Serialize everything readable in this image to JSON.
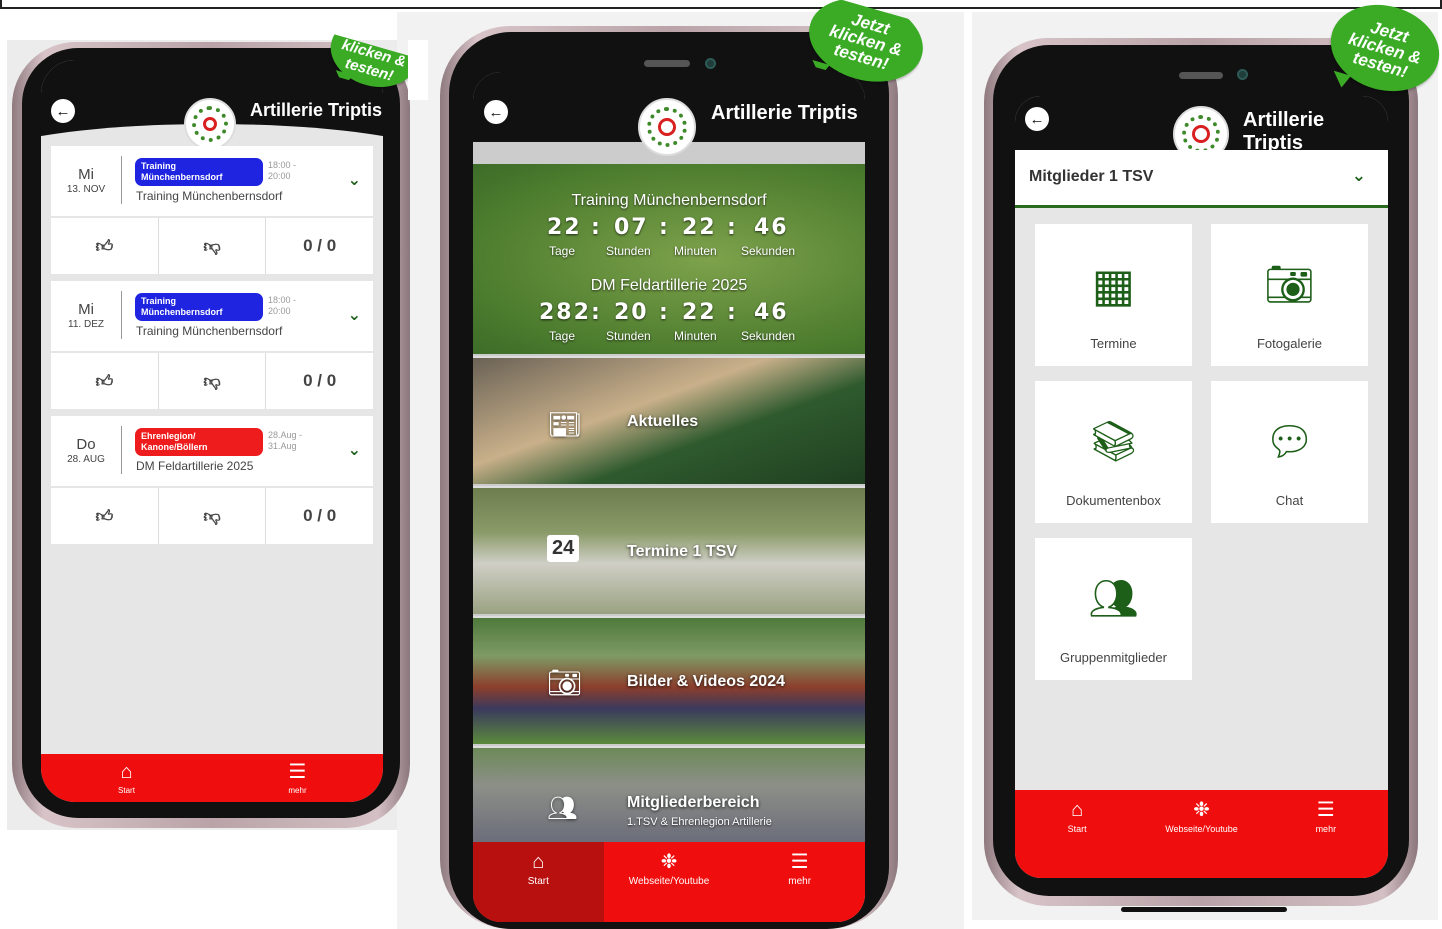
{
  "badge_text": "Jetzt\nklicken &\ntesten!",
  "app_title": "Artillerie Triptis",
  "colors": {
    "brand_green": "#1d5e18",
    "tabbar_red": "#ef0d0d",
    "pill_blue": "#1f24e0",
    "pill_red": "#ee1c1c"
  },
  "phone1": {
    "events": [
      {
        "dow": "Mi",
        "date": "13. NOV",
        "pill": "Training\nMünchenbernsdorf",
        "pill_color": "#1f24e0",
        "time": "18:00 -\n20:00",
        "name": "Training Münchenbernsdorf",
        "count": "0 / 0"
      },
      {
        "dow": "Mi",
        "date": "11. DEZ",
        "pill": "Training\nMünchenbernsdorf",
        "pill_color": "#1f24e0",
        "time": "18:00 -\n20:00",
        "name": "Training Münchenbernsdorf",
        "count": "0 / 0"
      },
      {
        "dow": "Do",
        "date": "28. AUG",
        "pill": "Ehrenlegion/\nKanone/Böllern",
        "pill_color": "#ee1c1c",
        "time": "28.Aug -\n31.Aug",
        "name": "DM Feldartillerie 2025",
        "count": "0 / 0"
      }
    ],
    "tabs": [
      {
        "label": "Start",
        "icon": "home-icon"
      },
      {
        "label": "mehr",
        "icon": "menu-icon"
      }
    ]
  },
  "phone2": {
    "countdowns": [
      {
        "title": "Training Münchenbernsdorf",
        "days": "22",
        "hours": "07",
        "minutes": "22",
        "seconds": "46"
      },
      {
        "title": "DM Feldartillerie 2025",
        "days": "282",
        "hours": "20",
        "minutes": "22",
        "seconds": "46"
      }
    ],
    "units": {
      "days": "Tage",
      "hours": "Stunden",
      "minutes": "Minuten",
      "seconds": "Sekunden"
    },
    "separator": ":",
    "tiles": [
      {
        "label": "Aktuelles",
        "icon": "newspaper-icon",
        "sub": ""
      },
      {
        "label": "Termine 1 TSV",
        "icon": "calendar-icon",
        "sub": "",
        "cal_day": "24"
      },
      {
        "label": "Bilder & Videos 2024",
        "icon": "camera-icon",
        "sub": ""
      },
      {
        "label": "Mitgliederbereich",
        "icon": "group-icon",
        "sub": "1.TSV & Ehrenlegion Artillerie"
      }
    ],
    "tabs": [
      {
        "label": "Start",
        "icon": "home-icon"
      },
      {
        "label": "Webseite/Youtube",
        "icon": "web-icon"
      },
      {
        "label": "mehr",
        "icon": "menu-icon"
      }
    ]
  },
  "phone3": {
    "group_select": "Mitglieder 1 TSV",
    "tiles": [
      {
        "label": "Termine",
        "icon": "calendar-icon"
      },
      {
        "label": "Fotogalerie",
        "icon": "camera-icon"
      },
      {
        "label": "Dokumentenbox",
        "icon": "binders-icon"
      },
      {
        "label": "Chat",
        "icon": "chat-icon"
      },
      {
        "label": "Gruppenmitglieder",
        "icon": "group-icon"
      }
    ],
    "tabs": [
      {
        "label": "Start",
        "icon": "home-icon"
      },
      {
        "label": "Webseite/Youtube",
        "icon": "web-icon"
      },
      {
        "label": "mehr",
        "icon": "menu-icon"
      }
    ]
  }
}
